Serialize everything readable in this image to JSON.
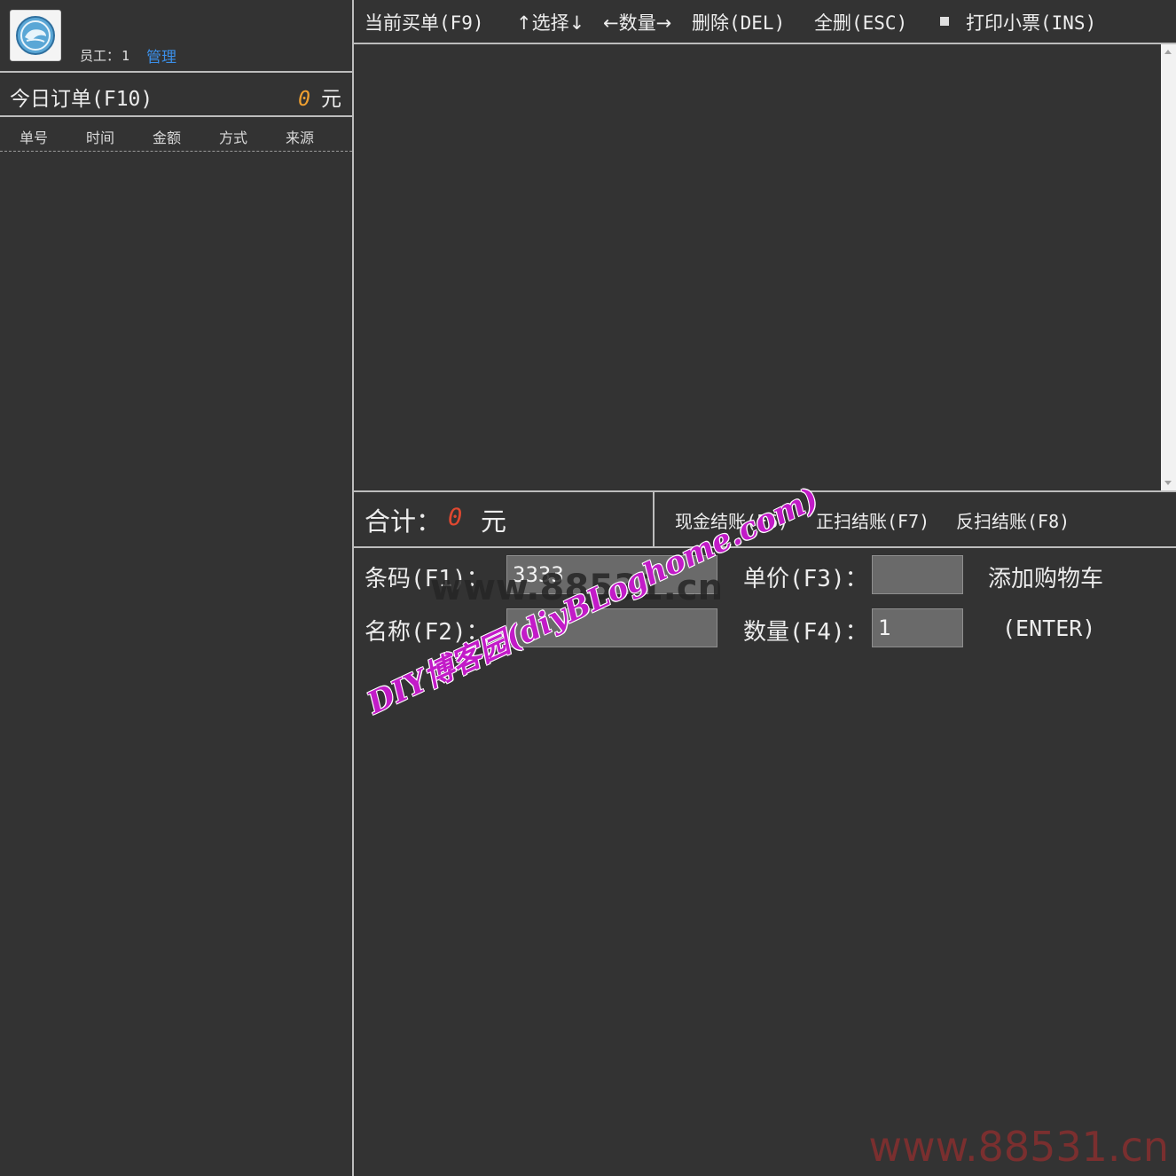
{
  "header": {
    "staff_label": "员工：",
    "staff_id": "1",
    "admin_link": "管理"
  },
  "today_orders": {
    "title": "今日订单(F10)",
    "amount": "0",
    "unit": "元",
    "columns": [
      "单号",
      "时间",
      "金额",
      "方式",
      "来源"
    ]
  },
  "toolbar": {
    "current_order": "当前买单(F9)",
    "select": "↑选择↓",
    "quantity": "←数量→",
    "delete": "删除(DEL)",
    "delete_all": "全删(ESC)",
    "print_receipt": "打印小票(INS)"
  },
  "totals": {
    "label": "合计：",
    "value": "0",
    "unit": "元",
    "cash_checkout": "现金结账(F6)",
    "forward_scan_checkout": "正扫结账(F7)",
    "reverse_scan_checkout": "反扫结账(F8)"
  },
  "form": {
    "barcode_label": "条码(F1)：",
    "barcode_value": "3333",
    "name_label": "名称(F2)：",
    "name_value": "",
    "price_label": "单价(F3)：",
    "price_value": "",
    "quantity_label": "数量(F4)：",
    "quantity_value": "1",
    "add_to_cart": "添加购物车",
    "enter_hint": "(ENTER)"
  },
  "watermarks": {
    "diagonal": "DIY博客园(diyBLoghome.com)",
    "faint": "www.88531.cn",
    "corner": "www.88531.cn"
  },
  "colors": {
    "background": "#333333",
    "accent_amount": "#f0a030",
    "total_value": "#e04830",
    "link": "#3b8fe8",
    "watermark": "#c21bc8"
  }
}
